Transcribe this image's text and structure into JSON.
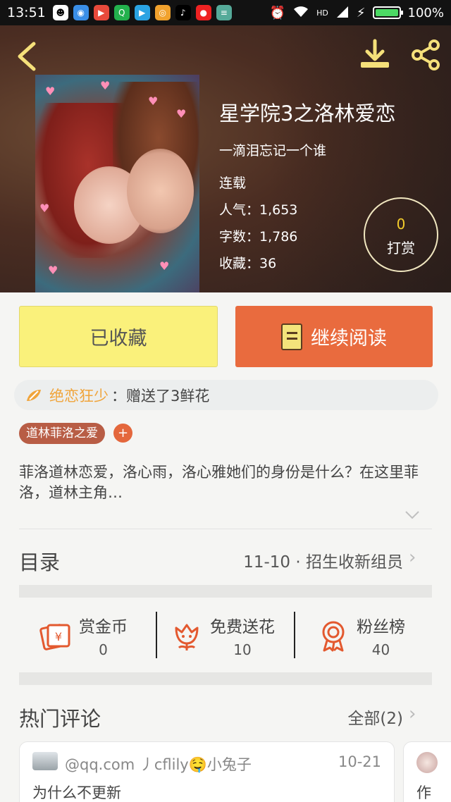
{
  "status_bar": {
    "time": "13:51",
    "battery": "100%",
    "network": "HD",
    "battery_level": 1.0
  },
  "header": {
    "title": "星学院3之洛林爱恋",
    "author": "一滴泪忘记一个谁",
    "status": "连载",
    "stats": {
      "popularity": "人气：1,653",
      "word_count": "字数：1,786",
      "favorites": "收藏：36"
    },
    "tip": {
      "count": "0",
      "label": "打赏"
    }
  },
  "actions": {
    "favorited_label": "已收藏",
    "continue_label": "继续阅读"
  },
  "gift": {
    "user": "绝恋狂少",
    "text": "：赠送了3鲜花"
  },
  "tag": {
    "label": "道林菲洛之爱",
    "add": "+"
  },
  "description": "菲洛道林恋爱，洛心雨，洛心雅她们的身份是什么？在这里菲洛，道林主角…",
  "toc": {
    "title": "目录",
    "latest": "11-10 · 招生收新组员"
  },
  "features": [
    {
      "label": "赏金币",
      "value": "0",
      "icon": "coin-envelope-icon"
    },
    {
      "label": "免费送花",
      "value": "10",
      "icon": "flower-icon"
    },
    {
      "label": "粉丝榜",
      "value": "40",
      "icon": "medal-icon"
    }
  ],
  "comments": {
    "title": "热门评论",
    "all": "全部(2)",
    "items": [
      {
        "user": "@qq.com 丿cflily🤤小兔子",
        "date": "10-21",
        "text": "为什么不更新"
      },
      {
        "user": "",
        "date": "",
        "text": "作"
      }
    ]
  },
  "colors": {
    "accent_orange": "#e96b3e",
    "fav_yellow": "#faf17b",
    "gift_orange": "#f0a43b",
    "tip_yellow": "#f3cc2b"
  }
}
